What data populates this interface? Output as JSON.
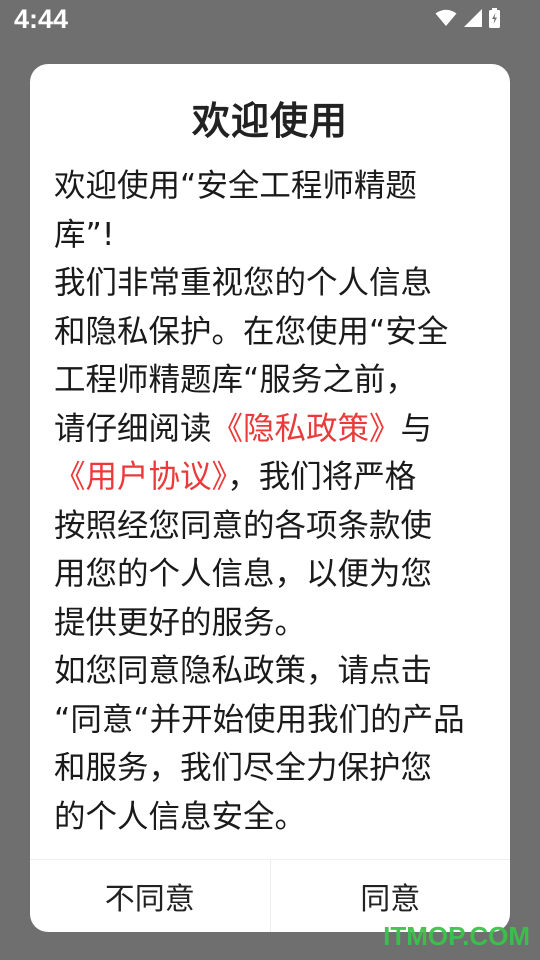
{
  "status_bar": {
    "time": "4:44",
    "icons": [
      "wifi-icon",
      "signal-icon",
      "battery-charging-icon"
    ]
  },
  "dialog": {
    "title": "欢迎使用",
    "body": {
      "line1": "欢迎使用“安全工程师精题",
      "line2": "库”!",
      "line3": "我们非常重视您的个人信息",
      "line4": "和隐私保护。在您使用“安全",
      "line5": "工程师精题库“服务之前，",
      "line6_prefix": "请仔细阅读",
      "privacy_link": "《隐私政策》",
      "line6_suffix": "与",
      "agreement_link": "《用户协议》",
      "line7_suffix": "，我们将严格",
      "line8": "按照经您同意的各项条款使",
      "line9": "用您的个人信息，以便为您",
      "line10": "提供更好的服务。",
      "line11": "如您同意隐私政策，请点击",
      "line12": "“同意“并开始使用我们的产品",
      "line13": "和服务，我们尽全力保护您",
      "line14": "的个人信息安全。"
    },
    "buttons": {
      "disagree": "不同意",
      "agree": "同意"
    }
  },
  "watermark": "ITMOP.COM",
  "colors": {
    "overlay": "#6f6f6f",
    "dialog_bg": "#ffffff",
    "link": "#ea3a3a",
    "watermark": "#39c34a"
  }
}
